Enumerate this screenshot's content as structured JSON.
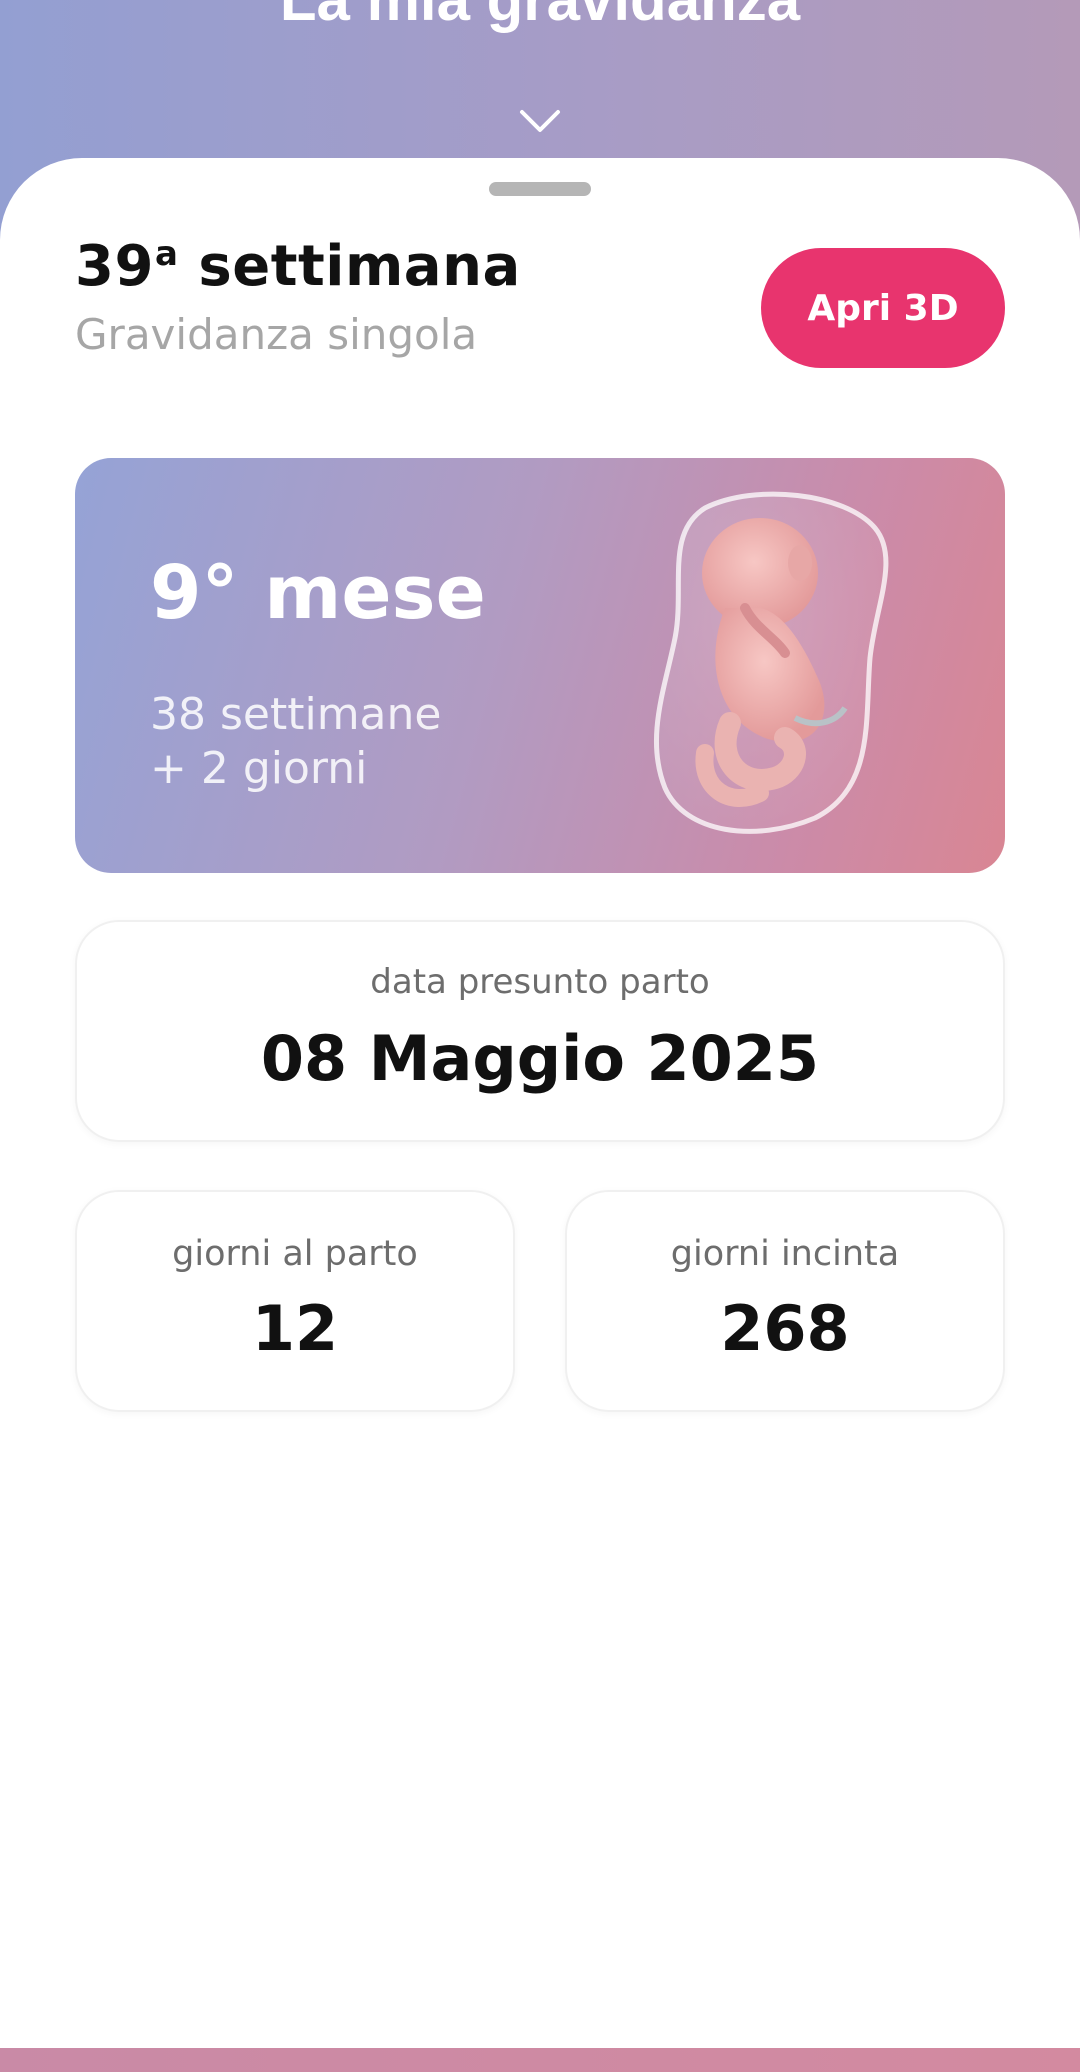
{
  "header": {
    "title": "La mia gravidanza",
    "collapse_icon": "chevron-down-icon"
  },
  "summary": {
    "week_number": "39",
    "week_ordinal": "a",
    "week_word": "settimana",
    "pregnancy_type": "Gravidanza singola",
    "open_3d_label": "Apri 3D",
    "accent_color": "#e8346e"
  },
  "month_card": {
    "month": "9° mese",
    "weeks_line": "38 settimane",
    "days_line": "+ 2 giorni",
    "image": "fetus-illustration"
  },
  "due_date": {
    "label": "data presunto parto",
    "value": "08 Maggio 2025"
  },
  "stats": {
    "days_to_birth": {
      "label": "giorni al parto",
      "value": "12"
    },
    "days_pregnant": {
      "label": "giorni incinta",
      "value": "268"
    }
  }
}
